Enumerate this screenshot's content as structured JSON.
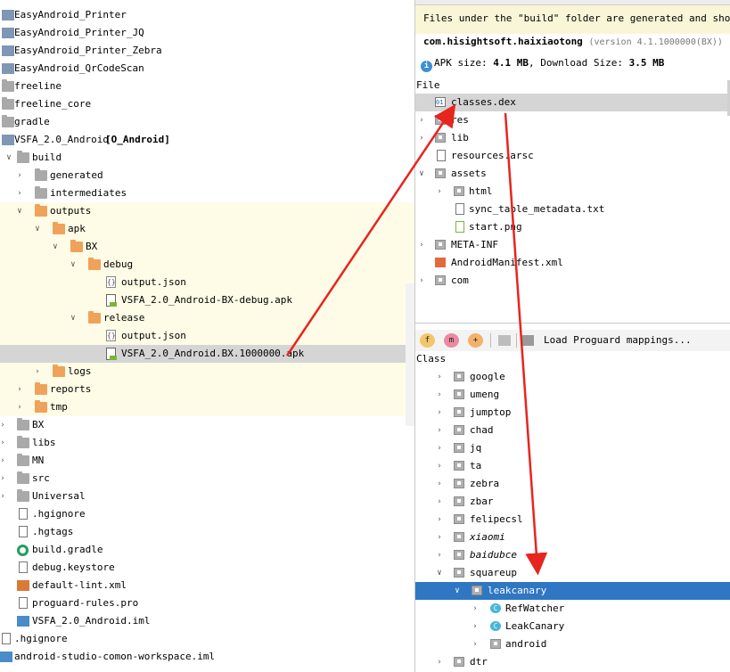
{
  "left_tree": {
    "rows": [
      {
        "label": "EasyAndroid_Printer",
        "icon": "module-icon"
      },
      {
        "label": "EasyAndroid_Printer_JQ",
        "icon": "module-icon"
      },
      {
        "label": "EasyAndroid_Printer_Zebra",
        "icon": "module-icon"
      },
      {
        "label": "EasyAndroid_QrCodeScan",
        "icon": "module-icon"
      },
      {
        "label": "freeline",
        "icon": "folder-icon"
      },
      {
        "label": "freeline_core",
        "icon": "folder-icon"
      },
      {
        "label": "gradle",
        "icon": "folder-icon"
      },
      {
        "label": "VSFA_2.0_Android",
        "suffix": "[O_Android]",
        "icon": "module-icon"
      },
      {
        "label": "build",
        "icon": "folder-icon"
      },
      {
        "label": "generated",
        "icon": "folder-icon"
      },
      {
        "label": "intermediates",
        "icon": "folder-icon"
      },
      {
        "label": "outputs",
        "icon": "folder-orange-icon"
      },
      {
        "label": "apk",
        "icon": "folder-orange-icon"
      },
      {
        "label": "BX",
        "icon": "folder-orange-icon"
      },
      {
        "label": "debug",
        "icon": "folder-orange-icon"
      },
      {
        "label": "output.json",
        "icon": "json-file-icon"
      },
      {
        "label": "VSFA_2.0_Android-BX-debug.apk",
        "icon": "apk-file-icon"
      },
      {
        "label": "release",
        "icon": "folder-orange-icon"
      },
      {
        "label": "output.json",
        "icon": "json-file-icon"
      },
      {
        "label": "VSFA_2.0_Android.BX.1000000.apk",
        "icon": "apk-file-icon"
      },
      {
        "label": "logs",
        "icon": "folder-orange-icon"
      },
      {
        "label": "reports",
        "icon": "folder-orange-icon"
      },
      {
        "label": "tmp",
        "icon": "folder-orange-icon"
      },
      {
        "label": "BX",
        "icon": "folder-icon"
      },
      {
        "label": "libs",
        "icon": "folder-icon"
      },
      {
        "label": "MN",
        "icon": "folder-icon"
      },
      {
        "label": "src",
        "icon": "folder-icon"
      },
      {
        "label": "Universal",
        "icon": "folder-icon"
      },
      {
        "label": ".hgignore",
        "icon": "text-file-icon"
      },
      {
        "label": ".hgtags",
        "icon": "text-file-icon"
      },
      {
        "label": "build.gradle",
        "icon": "gradle-icon"
      },
      {
        "label": "debug.keystore",
        "icon": "keystore-icon"
      },
      {
        "label": "default-lint.xml",
        "icon": "xml-file-icon"
      },
      {
        "label": "proguard-rules.pro",
        "icon": "text-file-icon"
      },
      {
        "label": "VSFA_2.0_Android.iml",
        "icon": "iml-file-icon"
      },
      {
        "label": ".hgignore",
        "icon": "text-file-icon"
      },
      {
        "label": "android-studio-comon-workspace.iml",
        "icon": "iml-file-icon"
      }
    ]
  },
  "apk_analyzer": {
    "banner": "Files under the \"build\" folder are generated and should no",
    "package_name": "com.hisightsoft.haixiaotong",
    "version": "(version 4.1.1000000(BX))",
    "size_prefix": "APK size: ",
    "apk_size": "4.1 MB",
    "size_sep": ", Download Size: ",
    "download_size": "3.5 MB",
    "file_header": "File",
    "files": [
      {
        "label": "classes.dex",
        "icon": "dex-icon"
      },
      {
        "label": "res",
        "icon": "folder-icon"
      },
      {
        "label": "lib",
        "icon": "folder-icon"
      },
      {
        "label": "resources.arsc",
        "icon": "file-icon"
      },
      {
        "label": "assets",
        "icon": "folder-icon"
      },
      {
        "label": "html",
        "icon": "folder-icon"
      },
      {
        "label": "sync_table_metadata.txt",
        "icon": "text-file-icon"
      },
      {
        "label": "start.png",
        "icon": "image-file-icon"
      },
      {
        "label": "META-INF",
        "icon": "folder-icon"
      },
      {
        "label": "AndroidManifest.xml",
        "icon": "xml-file-icon"
      },
      {
        "label": "com",
        "icon": "folder-icon"
      }
    ],
    "toolbar": {
      "btn_f": "f",
      "btn_m": "m",
      "btn_add": "+",
      "load_label": "Load Proguard mappings..."
    },
    "class_header": "Class",
    "classes": [
      {
        "label": "google",
        "icon": "package-icon"
      },
      {
        "label": "umeng",
        "icon": "package-icon"
      },
      {
        "label": "jumptop",
        "icon": "package-icon"
      },
      {
        "label": "chad",
        "icon": "package-icon"
      },
      {
        "label": "jq",
        "icon": "package-icon"
      },
      {
        "label": "ta",
        "icon": "package-icon"
      },
      {
        "label": "zebra",
        "icon": "package-icon"
      },
      {
        "label": "zbar",
        "icon": "package-icon"
      },
      {
        "label": "felipecsl",
        "icon": "package-icon"
      },
      {
        "label": "xiaomi",
        "icon": "package-icon"
      },
      {
        "label": "baidubce",
        "icon": "package-icon"
      },
      {
        "label": "squareup",
        "icon": "package-icon"
      },
      {
        "label": "leakcanary",
        "icon": "package-icon"
      },
      {
        "label": "RefWatcher",
        "icon": "class-icon"
      },
      {
        "label": "LeakCanary",
        "icon": "class-icon"
      },
      {
        "label": "android",
        "icon": "package-icon"
      },
      {
        "label": "dtr",
        "icon": "package-icon"
      }
    ]
  },
  "colors": {
    "selection_blue": "#2f77c3",
    "highlight_yellow": "#fefce6",
    "annotation_red": "#e8241f",
    "folder_orange": "#f0a25a"
  }
}
